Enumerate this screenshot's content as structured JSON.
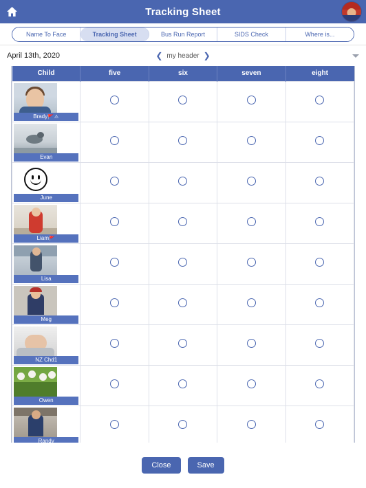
{
  "titlebar": {
    "title": "Tracking Sheet",
    "home_icon": "home-icon",
    "avatar_icon": "user-avatar"
  },
  "tabs": [
    {
      "label": "Name To Face",
      "active": false
    },
    {
      "label": "Tracking Sheet",
      "active": true
    },
    {
      "label": "Bus Run Report",
      "active": false
    },
    {
      "label": "SIDS Check",
      "active": false
    },
    {
      "label": "Where is...",
      "active": false
    }
  ],
  "subhead": {
    "date": "April 13th, 2020",
    "header_label": "my header",
    "prev_icon": "chevron-left-icon",
    "next_icon": "chevron-right-icon",
    "dropdown_icon": "caret-down-icon"
  },
  "table": {
    "columns": [
      "Child",
      "five",
      "six",
      "seven",
      "eight"
    ],
    "rows": [
      {
        "name": "Brady",
        "flags": "🚩⚠",
        "thumb": "photo-boy-blue-shirt"
      },
      {
        "name": "Evan",
        "flags": "",
        "thumb": "photo-birds"
      },
      {
        "name": "June",
        "flags": "",
        "thumb": "icon-smiley-face"
      },
      {
        "name": "Liam",
        "flags": "🚩",
        "thumb": "photo-toddler-red"
      },
      {
        "name": "Lisa",
        "flags": "",
        "thumb": "photo-person"
      },
      {
        "name": "Meg",
        "flags": "",
        "thumb": "photo-child-hat"
      },
      {
        "name": "NZ Chd1",
        "flags": "",
        "thumb": "photo-baby"
      },
      {
        "name": "Owen",
        "flags": "",
        "thumb": "photo-flowers"
      },
      {
        "name": "Randy",
        "flags": "",
        "thumb": "photo-child"
      }
    ],
    "cell_control": "radio-button-unselected"
  },
  "footer": {
    "close_label": "Close",
    "save_label": "Save"
  },
  "colors": {
    "brand": "#4a66b0",
    "tab_active_bg": "#d7def1",
    "name_bar": "#5572bd",
    "grid_line": "#dcdfe8"
  }
}
